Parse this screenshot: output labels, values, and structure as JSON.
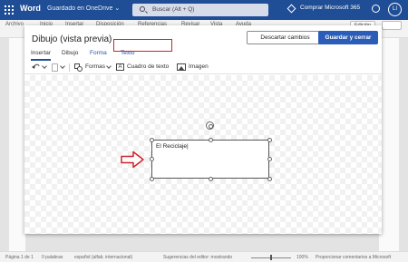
{
  "titlebar": {
    "app_name": "Word",
    "document_status": "Guardado en OneDrive",
    "search_placeholder": "Buscar (Alt + Q)",
    "buy_label": "Comprar Microsoft 365",
    "avatar_initials": "LI"
  },
  "ribbon": {
    "tabs": [
      "Archivo",
      "Inicio",
      "Insertar",
      "Disposición",
      "Referencias",
      "Revisar",
      "Vista",
      "Ayuda"
    ],
    "editing_label": "Edición"
  },
  "dialog": {
    "title": "Dibujo (vista previa)",
    "discard_label": "Descartar cambios",
    "save_close_label": "Guardar y cerrar",
    "tabs": [
      {
        "label": "Insertar",
        "active": true
      },
      {
        "label": "Dibujo",
        "active": false
      },
      {
        "label": "Forma",
        "active": false
      },
      {
        "label": "Texto",
        "active": false
      }
    ],
    "toolbar": {
      "shapes_label": "Formas",
      "textbox_label": "Cuadro de texto",
      "image_label": "Imagen"
    },
    "textbox_content": "El Reciclaje"
  },
  "statusbar": {
    "page": "Página 1 de 1",
    "words": "0 palabras",
    "language": "español (alfab. internacional)",
    "suggestions": "Sugerencias del editor: mostrando",
    "zoom": "100%",
    "feedback": "Proporcionar comentarios a Microsoft"
  },
  "colors": {
    "word_blue": "#1f4e96",
    "save_button": "#2b5cb8",
    "highlight_red": "#d0222a"
  }
}
